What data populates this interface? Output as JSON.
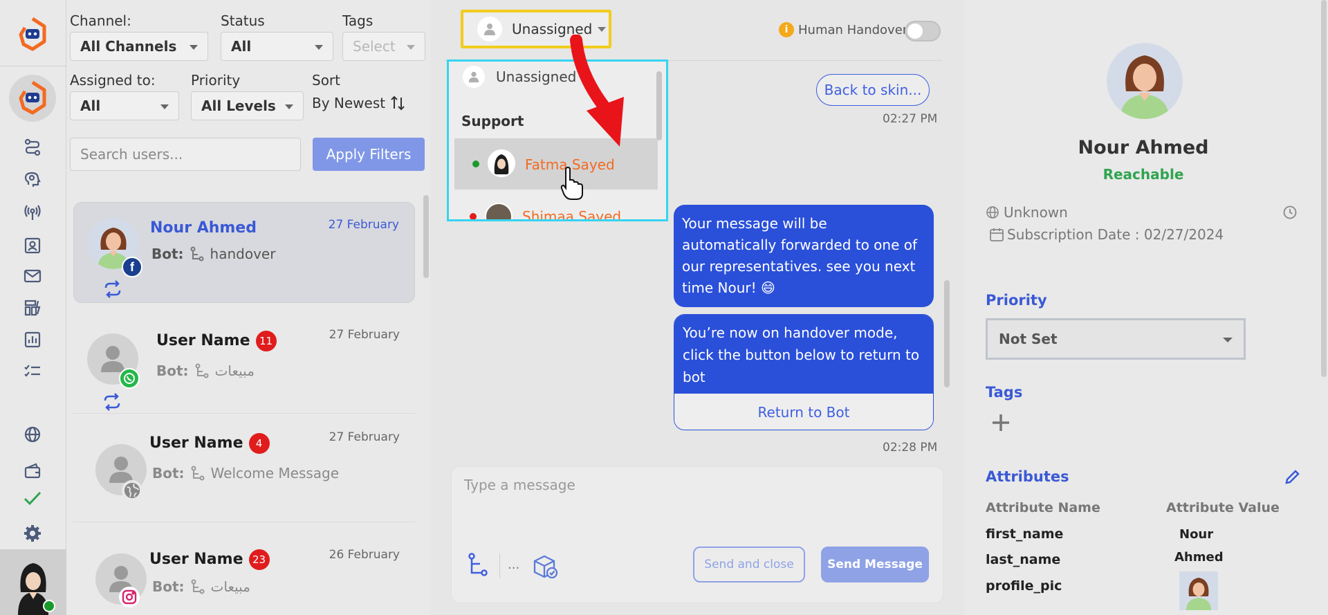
{
  "filters": {
    "channel_label": "Channel:",
    "channel_value": "All Channels",
    "status_label": "Status",
    "status_value": "All",
    "tags_label": "Tags",
    "tags_value": "Select",
    "assigned_label": "Assigned to:",
    "assigned_value": "All",
    "priority_label": "Priority",
    "priority_value": "All Levels",
    "sort_label": "Sort",
    "sort_value": "By Newest",
    "search_placeholder": "Search users...",
    "apply_label": "Apply Filters"
  },
  "conversations": [
    {
      "name": "Nour Ahmed",
      "date": "27 February",
      "bot_prefix": "Bot:",
      "preview": "handover",
      "channel": "facebook",
      "badge": ""
    },
    {
      "name": "User Name",
      "date": "27 February",
      "bot_prefix": "Bot:",
      "preview": "مبيعات",
      "channel": "whatsapp",
      "badge": "11"
    },
    {
      "name": "User Name",
      "date": "27 February",
      "bot_prefix": "Bot:",
      "preview": "Welcome Message",
      "channel": "web",
      "badge": "4"
    },
    {
      "name": "User Name",
      "date": "26 February",
      "bot_prefix": "Bot:",
      "preview": "مبيعات",
      "channel": "instagram",
      "badge": "23"
    }
  ],
  "chat": {
    "assign_value": "Unassigned",
    "handover_label": "Human Handover",
    "dropdown": {
      "unassigned": "Unassigned",
      "group": "Support",
      "agents": [
        {
          "name": "Fatma Sayed",
          "status_color": "#1a9a2a"
        },
        {
          "name": "Shimaa Sayed",
          "status_color": "#e01c1c"
        }
      ]
    },
    "back_button": "Back to skin...",
    "ts1": "02:27 PM",
    "msg1": "Your message will be automatically forwarded to one of our representatives. see you next time Nour! 😄",
    "msg2": "You’re now on handover mode, click the button below to return to bot",
    "msg2_button": "Return to Bot",
    "ts2": "02:28 PM",
    "composer_placeholder": "Type a message",
    "ellipsis": "...",
    "send_close": "Send and close",
    "send_message": "Send Message"
  },
  "profile": {
    "name": "Nour Ahmed",
    "status": "Reachable",
    "location": "Unknown",
    "subscription": "Subscription Date : 02/27/2024",
    "priority_heading": "Priority",
    "priority_value": "Not Set",
    "tags_heading": "Tags",
    "attributes_heading": "Attributes",
    "attr_name_header": "Attribute Name",
    "attr_value_header": "Attribute Value",
    "attributes": [
      {
        "key": "first_name",
        "value": "Nour"
      },
      {
        "key": "last_name",
        "value": "Ahmed"
      },
      {
        "key": "profile_pic",
        "value": ""
      }
    ]
  },
  "colors": {
    "brand_orange": "#f26a21",
    "accent_blue": "#2a4fd9",
    "highlight_yellow": "#f2cc1d",
    "highlight_cyan": "#36d4f2",
    "reachable_green": "#2fa44f"
  }
}
